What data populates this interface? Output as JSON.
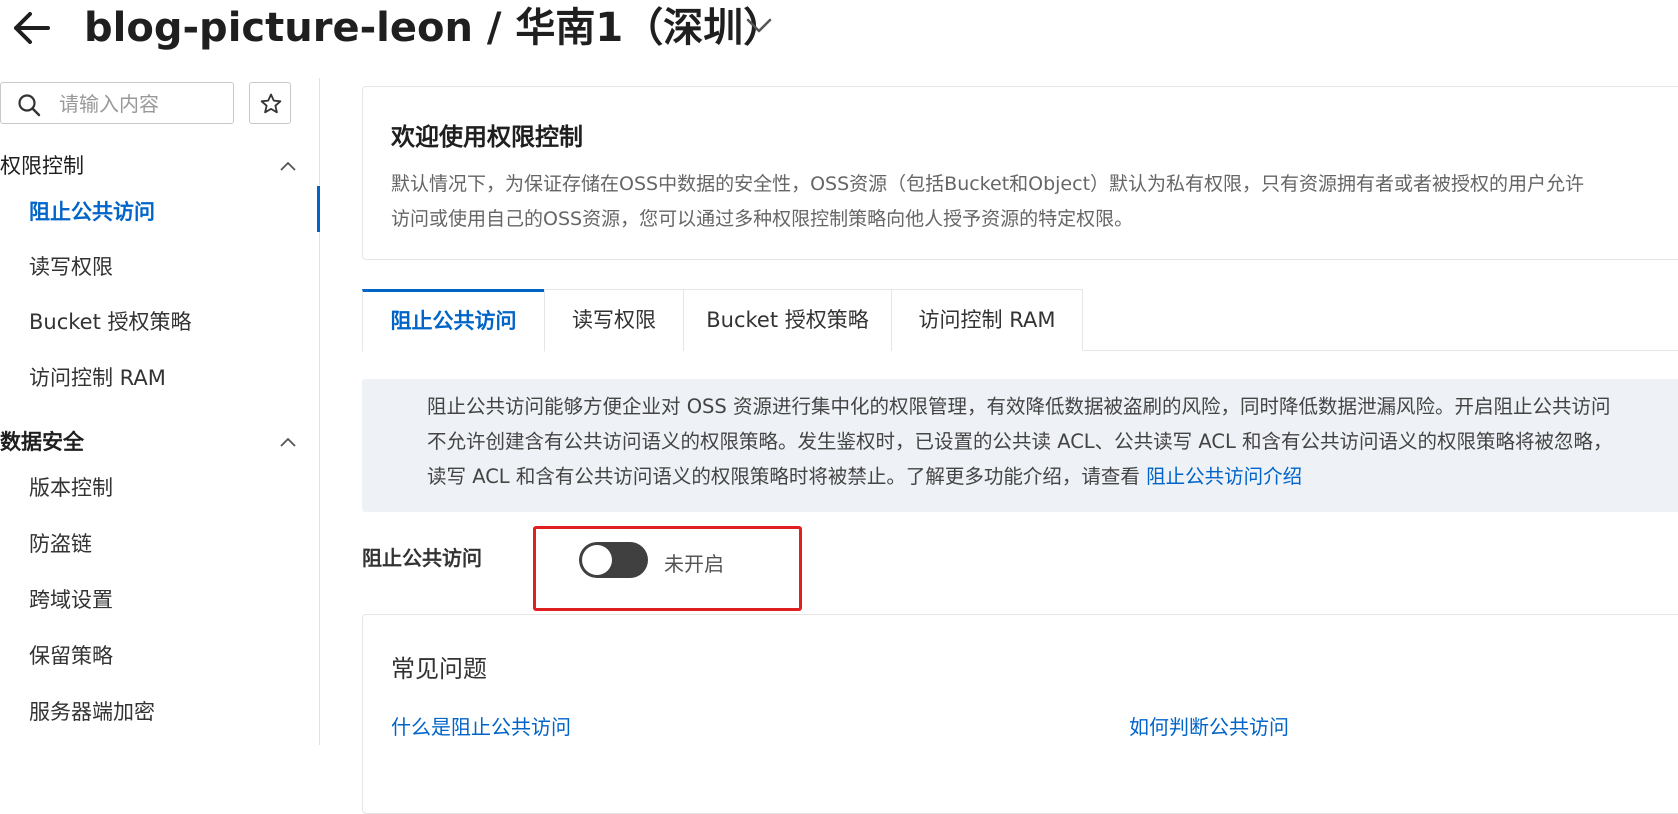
{
  "header": {
    "title": "blog-picture-leon / 华南1（深圳）"
  },
  "sidebar": {
    "search_placeholder": "请输入内容",
    "groups": [
      {
        "label": "权限控制",
        "items": [
          {
            "label": "阻止公共访问",
            "active": true
          },
          {
            "label": "读写权限"
          },
          {
            "label": "Bucket 授权策略"
          },
          {
            "label": "访问控制 RAM"
          }
        ]
      },
      {
        "label": "数据安全",
        "items": [
          {
            "label": "版本控制"
          },
          {
            "label": "防盗链"
          },
          {
            "label": "跨域设置"
          },
          {
            "label": "保留策略"
          },
          {
            "label": "服务器端加密"
          }
        ]
      }
    ]
  },
  "welcome": {
    "title": "欢迎使用权限控制",
    "line1": "默认情况下，为保证存储在OSS中数据的安全性，OSS资源（包括Bucket和Object）默认为私有权限，只有资源拥有者或者被授权的用户允许",
    "line2": "访问或使用自己的OSS资源，您可以通过多种权限控制策略向他人授予资源的特定权限。"
  },
  "tabs": [
    {
      "label": "阻止公共访问",
      "active": true
    },
    {
      "label": "读写权限"
    },
    {
      "label": "Bucket 授权策略"
    },
    {
      "label": "访问控制 RAM"
    }
  ],
  "info": {
    "line1": "阻止公共访问能够方便企业对 OSS 资源进行集中化的权限管理，有效降低数据被盗刷的风险，同时降低数据泄漏风险。开启阻止公共访问",
    "line2": "不允许创建含有公共访问语义的权限策略。发生鉴权时，已设置的公共读 ACL、公共读写 ACL 和含有公共访问语义的权限策略将被忽略，",
    "line3": "读写 ACL 和含有公共访问语义的权限策略时将被禁止。了解更多功能介绍，请查看 ",
    "link": "阻止公共访问介绍"
  },
  "setting": {
    "label": "阻止公共访问",
    "state": "未开启",
    "enabled": false
  },
  "faq": {
    "title": "常见问题",
    "links": [
      "什么是阻止公共访问",
      "如何判断公共访问"
    ]
  },
  "colors": {
    "accent": "#0064c8",
    "highlight": "#e02020",
    "toggle_off": "#404040",
    "info_bg": "#eef2f6"
  }
}
